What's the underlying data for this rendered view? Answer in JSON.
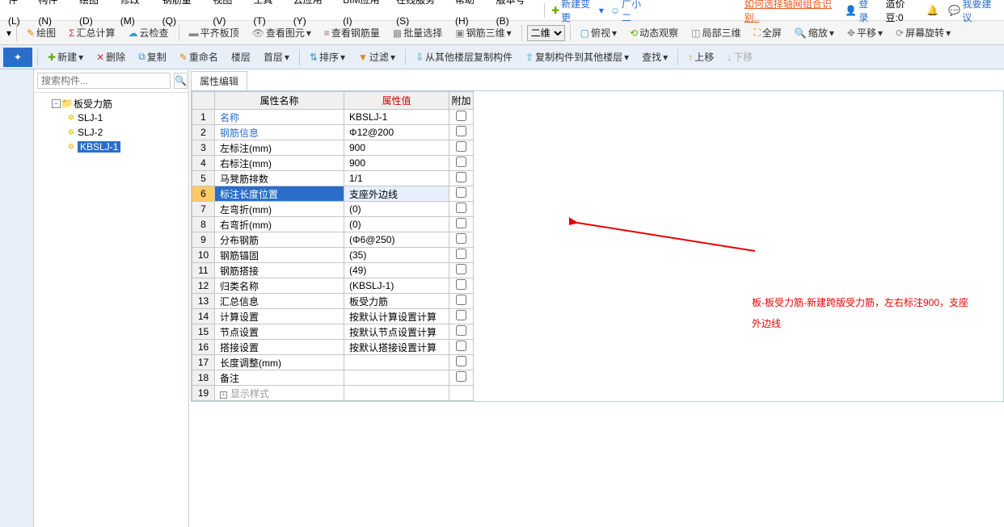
{
  "menu": {
    "items": [
      "件(L)",
      "构件(N)",
      "绘图(D)",
      "修改(M)",
      "钢筋量(Q)",
      "视图(V)",
      "工具(T)",
      "云应用(Y)",
      "BIM应用(I)",
      "在线服务(S)",
      "帮助(H)",
      "版本号(B)"
    ],
    "new_change": "新建变更",
    "user": "广小二",
    "help_link": "如何选择轴网组合识别..",
    "login": "登录",
    "coins_label": "造价豆:",
    "coins_value": "0",
    "suggest": "我要建议"
  },
  "toolbar1": {
    "items": [
      "绘图",
      "汇总计算",
      "云检查",
      "平齐板顶",
      "查看图元",
      "查看钢筋量",
      "批量选择",
      "钢筋三维"
    ],
    "dim_select": "二维",
    "right_items": [
      "俯视",
      "动态观察",
      "局部三维",
      "全屏",
      "缩放",
      "平移",
      "屏幕旋转"
    ]
  },
  "toolbar2": {
    "tab": " ",
    "items": [
      "新建",
      "删除",
      "复制",
      "重命名",
      "楼层",
      "首层"
    ],
    "sort": "排序",
    "filter": "过滤",
    "copy_from": "从其他楼层复制构件",
    "copy_to": "复制构件到其他楼层",
    "find": "查找",
    "up": "上移",
    "down": "下移"
  },
  "search": {
    "placeholder": "搜索构件..."
  },
  "tree": {
    "root": "板受力筋",
    "children": [
      "SLJ-1",
      "SLJ-2",
      "KBSLJ-1"
    ],
    "selected": 2
  },
  "prop": {
    "tab": "属性编辑",
    "headers": {
      "name": "属性名称",
      "value": "属性值",
      "extra": "附加"
    },
    "rows": [
      {
        "n": "名称",
        "v": "KBSLJ-1",
        "link": true,
        "chk": false
      },
      {
        "n": "钢筋信息",
        "v": "Φ12@200",
        "link": true,
        "chk": true
      },
      {
        "n": "左标注(mm)",
        "v": "900",
        "chk": true
      },
      {
        "n": "右标注(mm)",
        "v": "900",
        "chk": true
      },
      {
        "n": "马凳筋排数",
        "v": "1/1",
        "chk": true
      },
      {
        "n": "标注长度位置",
        "v": "支座外边线",
        "chk": true,
        "sel": true
      },
      {
        "n": "左弯折(mm)",
        "v": "(0)",
        "chk": true
      },
      {
        "n": "右弯折(mm)",
        "v": "(0)",
        "chk": true
      },
      {
        "n": "分布钢筋",
        "v": "(Φ6@250)",
        "chk": true
      },
      {
        "n": "钢筋锚固",
        "v": "(35)",
        "chk": false
      },
      {
        "n": "钢筋搭接",
        "v": "(49)",
        "chk": false
      },
      {
        "n": "归类名称",
        "v": "(KBSLJ-1)",
        "chk": true
      },
      {
        "n": "汇总信息",
        "v": "板受力筋",
        "chk": true
      },
      {
        "n": "计算设置",
        "v": "按默认计算设置计算",
        "chk": false
      },
      {
        "n": "节点设置",
        "v": "按默认节点设置计算",
        "chk": false
      },
      {
        "n": "搭接设置",
        "v": "按默认搭接设置计算",
        "chk": false
      },
      {
        "n": "长度调整(mm)",
        "v": "",
        "chk": true
      },
      {
        "n": "备注",
        "v": "",
        "chk": true
      },
      {
        "n": "显示样式",
        "v": "",
        "dim": true,
        "exp": true
      }
    ]
  },
  "annotation": {
    "line1": "板-板受力筋-新建跨版受力筋，左右标注900，支座",
    "line2": "外边线"
  }
}
